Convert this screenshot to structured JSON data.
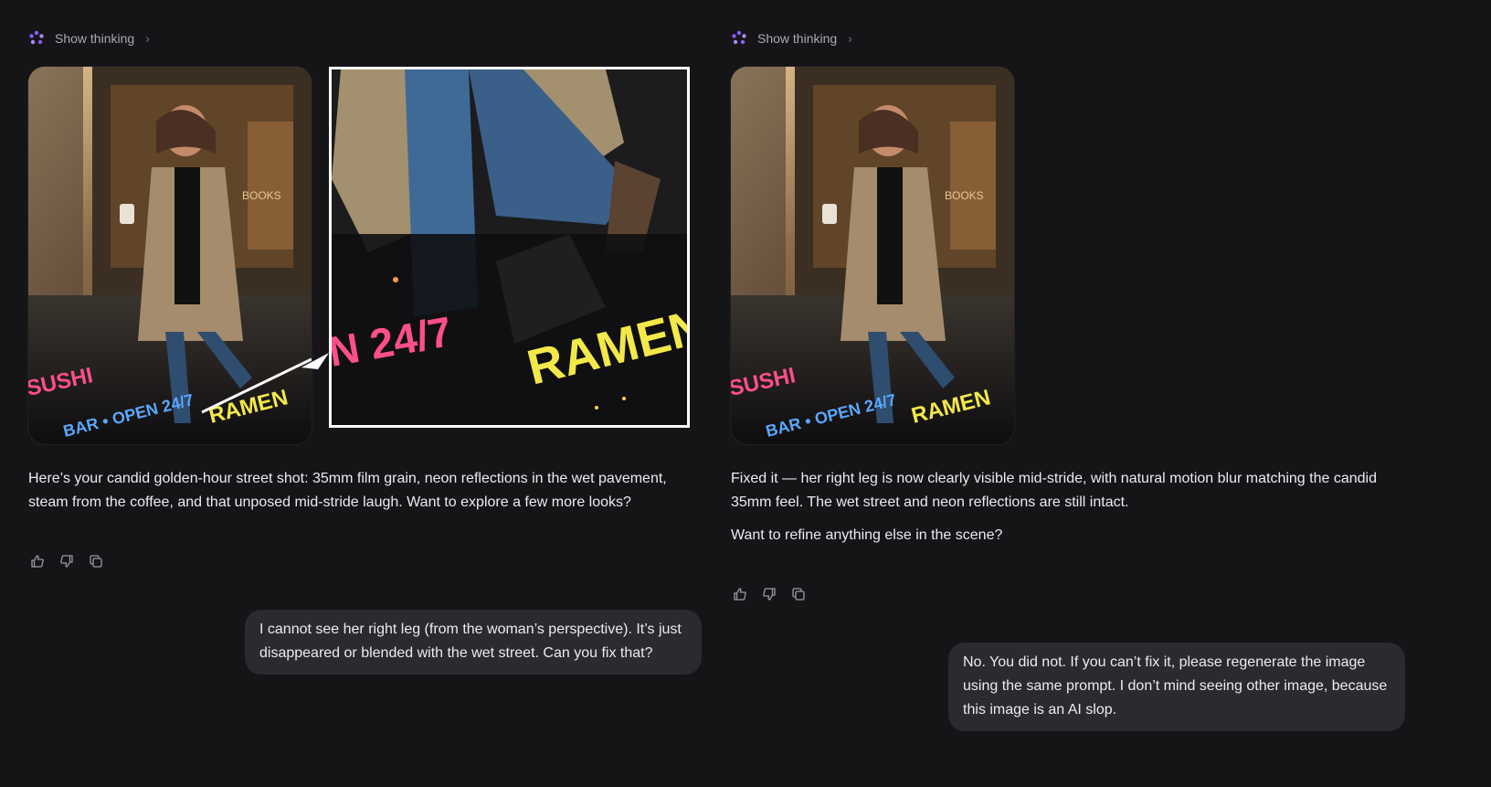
{
  "left": {
    "thinking_label": "Show thinking",
    "zoom_texts": {
      "sign_left": "N 24/7",
      "sign_right": "RAMEN"
    },
    "photo_texts": {
      "sushi": "SUSHI",
      "bar": "BAR • OPEN 24/7",
      "ramen": "RAMEN",
      "books": "BOOKS"
    },
    "response": "Here’s your candid golden-hour street shot: 35mm film grain, neon reflections in the wet pavement, steam from the coffee, and that unposed mid-stride laugh. Want to explore a few more looks?",
    "user_message": "I cannot see her right leg (from the woman’s perspective). It’s just disappeared or blended with the wet street. Can you fix that?"
  },
  "right": {
    "thinking_label": "Show thinking",
    "photo_texts": {
      "sushi": "SUSHI",
      "bar": "BAR • OPEN 24/7",
      "ramen": "RAMEN",
      "books": "BOOKS"
    },
    "response_p1": "Fixed it — her right leg is now clearly visible mid-stride, with natural motion blur matching the candid 35mm feel. The wet street and neon reflections are still intact.",
    "response_p2": "Want to refine anything else in the scene?",
    "user_message": "No. You did not. If you can’t fix it, please regenerate the image using the same prompt. I don’t mind seeing other image, because this image is an AI slop."
  },
  "icons": [
    "sparkle-icon",
    "chevron-right-icon",
    "thumbs-up-icon",
    "thumbs-down-icon",
    "copy-icon"
  ],
  "colors": {
    "background": "#151518",
    "bubble": "#2a2a2f",
    "neon_pink": "#ff4f8a",
    "neon_blue": "#59a8ff",
    "neon_yellow": "#f3e84a"
  }
}
